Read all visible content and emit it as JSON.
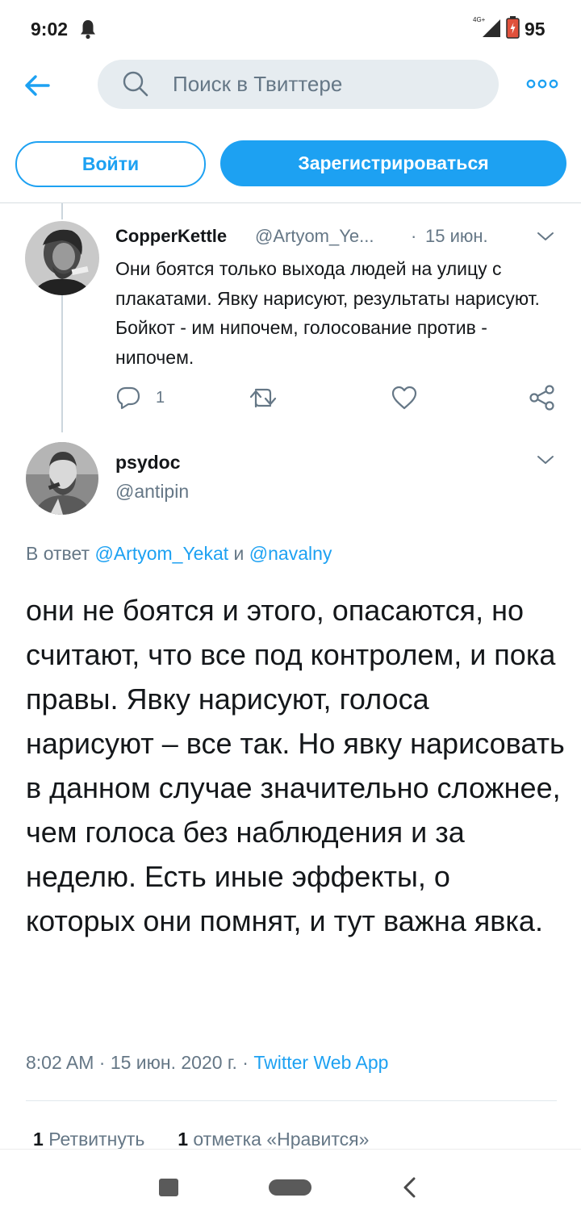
{
  "status_bar": {
    "time": "9:02",
    "network": "4G+",
    "battery": "95",
    "icons": [
      "bell-icon",
      "signal-icon",
      "battery-icon"
    ]
  },
  "top_bar": {
    "search_placeholder": "Поиск в Твиттере",
    "icons": [
      "back-arrow-icon",
      "search-icon",
      "more-dots-icon"
    ]
  },
  "auth": {
    "login_label": "Войти",
    "signup_label": "Зарегистрироваться"
  },
  "parent_tweet": {
    "display_name": "CopperKettle",
    "handle": "@Artyom_Ye...",
    "separator": "·",
    "date": "15 июн.",
    "text": "Они боятся только выхода людей на улицу с плакатами. Явку нарисуют, результаты нарисуют. Бойкот - им нипочем, голосование против - нипочем.",
    "reply_count": "1"
  },
  "main_tweet": {
    "display_name": "psydoc",
    "handle": "@antipin",
    "reply_prefix": "В ответ",
    "reply_mention_1": "@Artyom_Yekat",
    "reply_joiner": "и",
    "reply_mention_2": "@navalny",
    "text": "они не боятся и этого, опасаются, но считают, что все под контролем, и пока правы. Явку нарисуют, голоса нарисуют – все так. Но явку нарисовать в данном случае  значительно сложнее, чем голоса без наблюдения и за неделю. Есть иные эффекты, о которых они помнят, и тут важна явка.",
    "timestamp": "8:02 AM · 15 июн. 2020 г.",
    "meta_separator": "·",
    "source": "Twitter Web App",
    "retweet_count": "1",
    "retweet_label": "Ретвитнуть",
    "like_count": "1",
    "like_label": "отметка «Нравится»"
  },
  "colors": {
    "accent": "#1da1f2",
    "secondary_text": "#657786",
    "search_bg": "#e6ecf0"
  }
}
